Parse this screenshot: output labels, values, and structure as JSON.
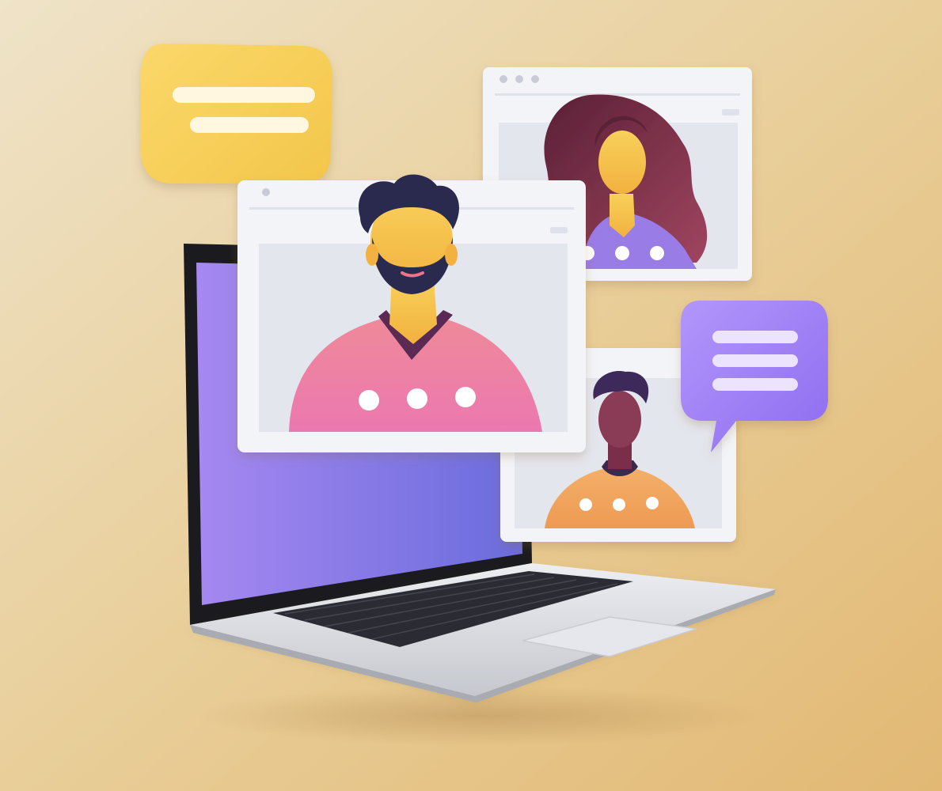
{
  "scene": {
    "colors": {
      "background_light": "#efe3c8",
      "background_warm": "#e4bd7a",
      "screen_purple": "#9b86ee",
      "screen_blue": "#6f6fe0",
      "laptop_silver": "#d9dadf",
      "window_frame": "#f3f4f8",
      "window_body": "#e4e6ee",
      "bubble_yellow": "#f7cf55",
      "bubble_purple": "#a685f5",
      "man_sweater": "#ee88a8",
      "woman_top": "#9a7be6",
      "woman_hair": "#7a2f4a",
      "boy_sweater": "#f0a55b",
      "skin_light": "#f5c453",
      "hair_navy": "#2a2b4f",
      "boy_skin": "#8a3a55"
    },
    "icons": [
      "yellow-chat-bubble-icon",
      "purple-chat-bubble-icon",
      "laptop-icon",
      "video-call-window-icon"
    ],
    "participants": [
      {
        "id": "man-with-beard",
        "sweater_dots": 3
      },
      {
        "id": "woman-long-hair",
        "sweater_dots": 3
      },
      {
        "id": "young-man",
        "sweater_dots": 3
      }
    ]
  }
}
